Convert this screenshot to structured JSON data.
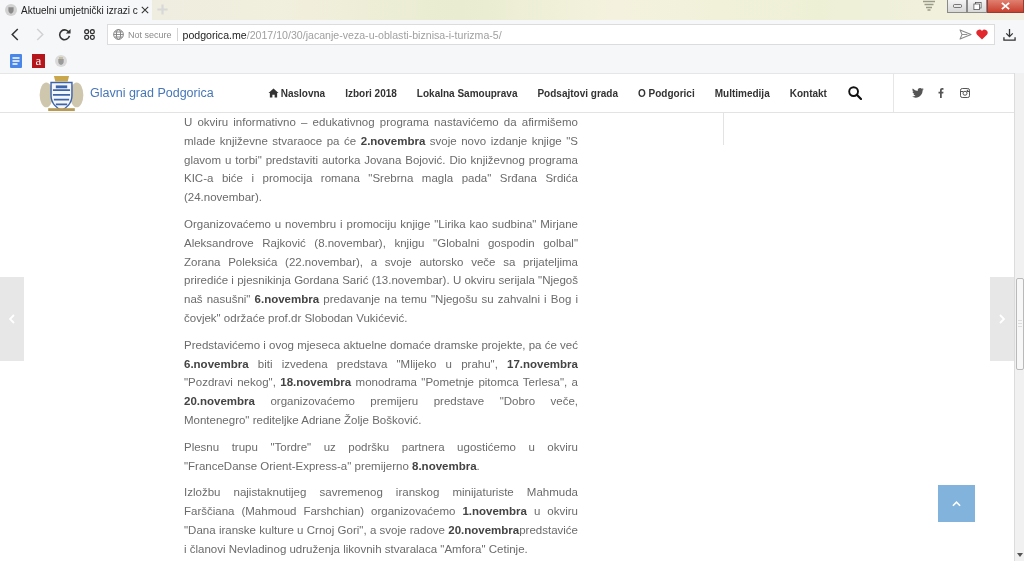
{
  "browser": {
    "tab": {
      "title": "Aktuelni umjetnički izrazi c",
      "selected": true
    },
    "nav_buttons": [
      {
        "kind": "back",
        "disabled": false
      },
      {
        "kind": "forward",
        "disabled": true
      },
      {
        "kind": "reload",
        "disabled": false
      },
      {
        "kind": "speed_dial",
        "disabled": false
      }
    ],
    "address_bar": {
      "security": "Not secure",
      "host": "podgorica.me",
      "path": "/2017/10/30/jacanje-veza-u-oblasti-biznisa-i-turizma-5/"
    },
    "bookmarks": [
      {
        "kind": "document"
      },
      {
        "kind": "letter",
        "label": "a"
      },
      {
        "kind": "site"
      }
    ]
  },
  "site_header": {
    "title": "Glavni grad Podgorica",
    "menu": [
      {
        "kind": "home",
        "label": "Naslovna"
      },
      {
        "kind": "link",
        "label": "Izbori 2018"
      },
      {
        "kind": "link",
        "label": "Lokalna Samouprava"
      },
      {
        "kind": "link",
        "label": "Podsajtovi grada"
      },
      {
        "kind": "link",
        "label": "O Podgorici"
      },
      {
        "kind": "link",
        "label": "Multimedija"
      },
      {
        "kind": "link",
        "label": "Kontakt"
      }
    ],
    "social": [
      {
        "kind": "twitter"
      },
      {
        "kind": "facebook"
      },
      {
        "kind": "instagram"
      }
    ]
  },
  "article": {
    "paragraphs": [
      "U okviru informativno – edukativnog programa nastavićemo da afirmišemo mlade književne stvaraoce pa će **2.novembra** svoje novo izdanje knjige \"S glavom u torbi\" predstaviti autorka Jovana Bojović. Dio književnog programa KIC-a biće i promocija romana \"Srebrna magla pada\" Srđana Srdića (24.novembar).",
      "Organizovaćemo u novembru i promociju knjige \"Lirika kao sudbina\" Mirjane Aleksandrove Rajković (8.novembar), knjigu \"Globalni gospodin golbal\" Zorana Poleksića (22.novembar), a svoje autorsko veče sa prijateljima prirediće i pjesnikinja Gordana Sarić (13.novembar). U okviru serijala \"Njegoš naš nasušni\" **6.novembra** predavanje na temu \"Njegošu su zahvalni i Bog i čovjek\" održaće prof.dr Slobodan Vukićević.",
      "Predstavićemo i ovog mjeseca aktuelne domaće dramske projekte, pa će već **6.novembra** biti izvedena predstava \"Mlijeko u prahu\", **17.novembra** \"Pozdravi nekog\", **18.novembra** monodrama \"Pometnje pitomca Terlesa\", a **20.novembra** organizovaćemo premijeru predstave \"Dobro veče, Montenegro\" rediteljke Adriane Žolje Bošković.",
      "Plesnu trupu \"Tordre\" uz podršku partnera ugostićemo u okviru \"FranceDanse Orient-Express-a\" premijerno **8.novembra**.",
      "Izložbu najistaknutijeg savremenog iranskog minijaturiste Mahmuda Farščiana (Mahmoud Farshchian) organizovaćemo **1.novembra** u okviru \"Dana iranske kulture u Crnoj Gori\", a svoje radove **20.novembra**predstaviće i članovi Nevladinog udruženja likovnih stvaralaca \"Amfora\" Cetinje."
    ]
  }
}
